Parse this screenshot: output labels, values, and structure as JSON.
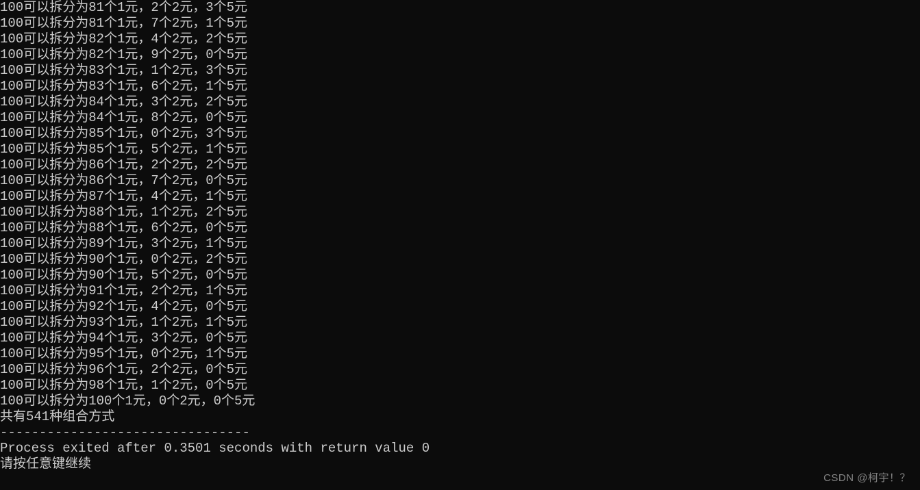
{
  "terminal": {
    "prefix": "100可以拆分为",
    "unit1": "个1元，",
    "unit2": "个2元，",
    "unit3": "个5元",
    "rows": [
      {
        "a": 81,
        "b": 2,
        "c": 3
      },
      {
        "a": 81,
        "b": 7,
        "c": 1
      },
      {
        "a": 82,
        "b": 4,
        "c": 2
      },
      {
        "a": 82,
        "b": 9,
        "c": 0
      },
      {
        "a": 83,
        "b": 1,
        "c": 3
      },
      {
        "a": 83,
        "b": 6,
        "c": 1
      },
      {
        "a": 84,
        "b": 3,
        "c": 2
      },
      {
        "a": 84,
        "b": 8,
        "c": 0
      },
      {
        "a": 85,
        "b": 0,
        "c": 3
      },
      {
        "a": 85,
        "b": 5,
        "c": 1
      },
      {
        "a": 86,
        "b": 2,
        "c": 2
      },
      {
        "a": 86,
        "b": 7,
        "c": 0
      },
      {
        "a": 87,
        "b": 4,
        "c": 1
      },
      {
        "a": 88,
        "b": 1,
        "c": 2
      },
      {
        "a": 88,
        "b": 6,
        "c": 0
      },
      {
        "a": 89,
        "b": 3,
        "c": 1
      },
      {
        "a": 90,
        "b": 0,
        "c": 2
      },
      {
        "a": 90,
        "b": 5,
        "c": 0
      },
      {
        "a": 91,
        "b": 2,
        "c": 1
      },
      {
        "a": 92,
        "b": 4,
        "c": 0
      },
      {
        "a": 93,
        "b": 1,
        "c": 1
      },
      {
        "a": 94,
        "b": 3,
        "c": 0
      },
      {
        "a": 95,
        "b": 0,
        "c": 1
      },
      {
        "a": 96,
        "b": 2,
        "c": 0
      },
      {
        "a": 98,
        "b": 1,
        "c": 0
      },
      {
        "a": 100,
        "b": 0,
        "c": 0
      }
    ],
    "summary": "共有541种组合方式",
    "separator": "--------------------------------",
    "exit_line": "Process exited after 0.3501 seconds with return value 0",
    "prompt": "请按任意键继续"
  },
  "watermark": "CSDN @柯宇！？"
}
